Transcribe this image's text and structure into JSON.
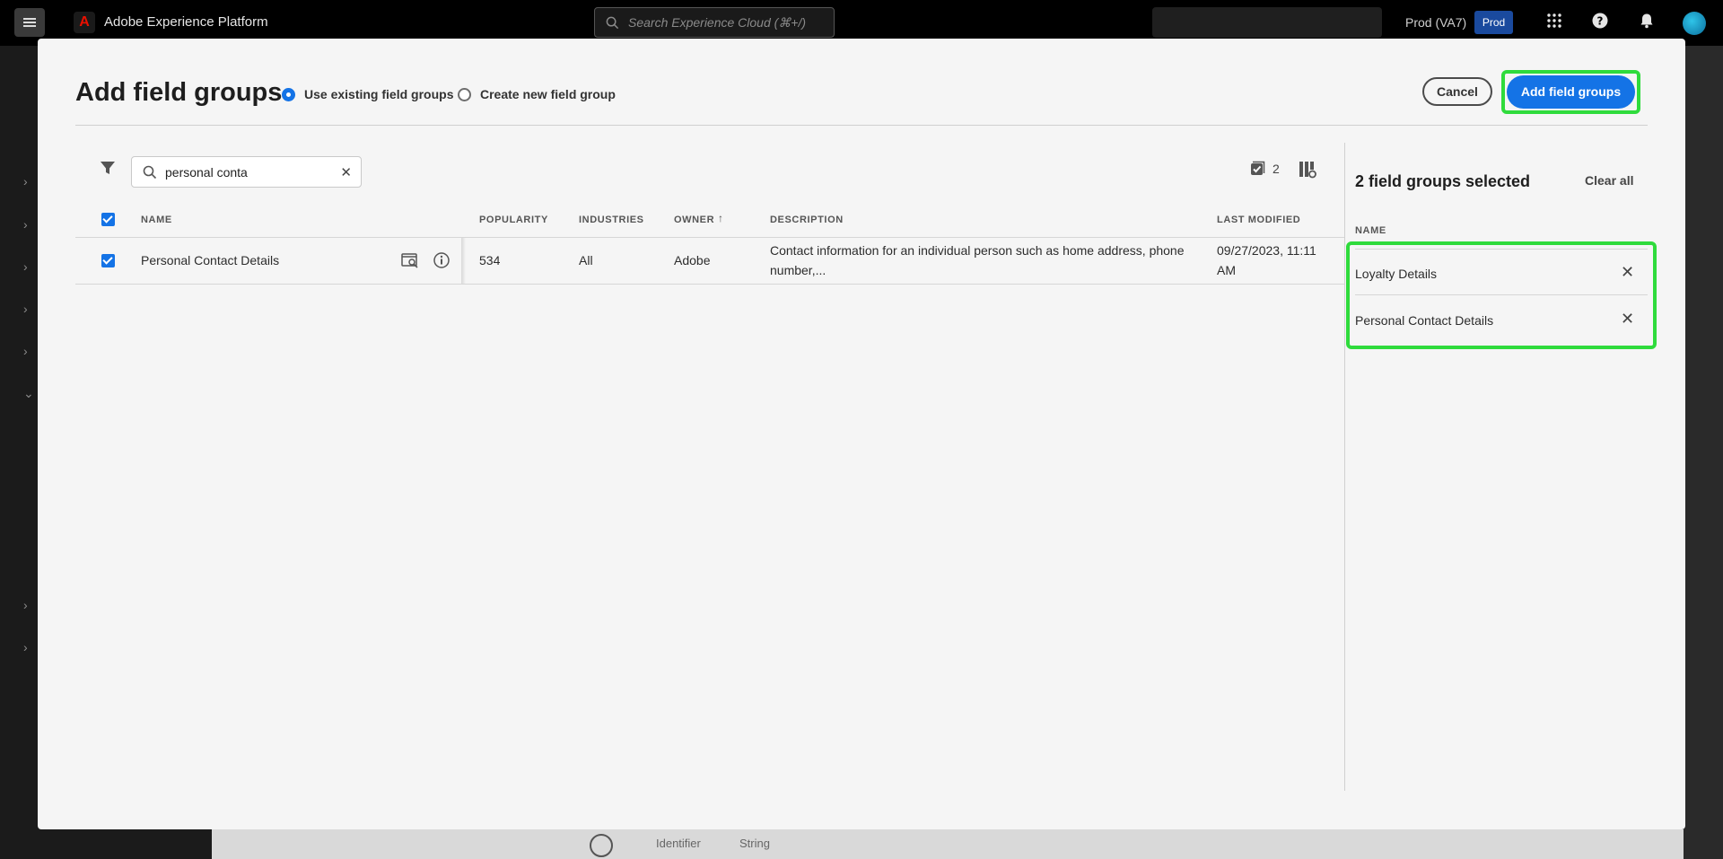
{
  "app": {
    "title": "Adobe Experience Platform",
    "logo_letter": "A"
  },
  "topbar": {
    "search_placeholder": "Search Experience Cloud (⌘+/)",
    "org": "Prod (VA7)",
    "env_badge": "Prod",
    "icons": [
      "apps-grid-icon",
      "help-icon",
      "bell-icon",
      "avatar"
    ]
  },
  "modal": {
    "title": "Add field groups",
    "options": [
      {
        "label": "Use existing field groups",
        "selected": true
      },
      {
        "label": "Create new field group",
        "selected": false
      }
    ],
    "cancel_label": "Cancel",
    "add_label": "Add field groups"
  },
  "toolbar": {
    "search_value": "personal conta",
    "selected_count": "2"
  },
  "table": {
    "headers": {
      "name": "NAME",
      "popularity": "POPULARITY",
      "industries": "INDUSTRIES",
      "owner": "OWNER",
      "description": "DESCRIPTION",
      "last_modified": "LAST MODIFIED"
    },
    "rows": [
      {
        "name": "Personal Contact Details",
        "popularity": "534",
        "industries": "All",
        "owner": "Adobe",
        "description_line1": "Contact information for an individual person such as home address, phone",
        "description_line2": "number,...",
        "modified_line1": "09/27/2023, 11:11",
        "modified_line2": "AM",
        "checked": true
      }
    ]
  },
  "panel": {
    "title": "2 field groups selected",
    "clear_all": "Clear all",
    "header": "NAME",
    "items": [
      "Loyalty Details",
      "Personal Contact Details"
    ]
  },
  "background": {
    "field_label": "Identifier",
    "field_type": "String"
  },
  "colors": {
    "accent": "#1473e6",
    "highlight": "#2fdb3c",
    "topbar": "#000000"
  }
}
